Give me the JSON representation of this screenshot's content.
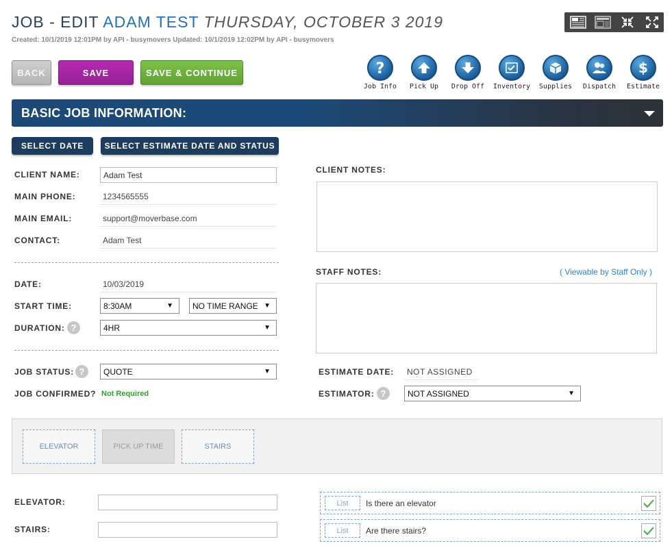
{
  "header": {
    "title_prefix": "JOB - EDIT",
    "client_name": "ADAM TEST",
    "job_date": "THURSDAY, OCTOBER 3 2019",
    "meta": "Created: 10/1/2019 12:01PM by API - busymovers Updated: 10/1/2019 12:02PM by API - busymovers"
  },
  "view_icons": [
    "layout-detail-icon",
    "layout-simple-icon",
    "collapse-icon",
    "expand-icon"
  ],
  "actions": {
    "back": "BACK",
    "save": "SAVE",
    "save_continue": "SAVE & CONTINUE"
  },
  "nav": [
    {
      "label": "Job Info",
      "icon": "question-icon"
    },
    {
      "label": "Pick Up",
      "icon": "arrow-up-icon"
    },
    {
      "label": "Drop Off",
      "icon": "arrow-down-icon"
    },
    {
      "label": "Inventory",
      "icon": "inventory-icon"
    },
    {
      "label": "Supplies",
      "icon": "box-icon"
    },
    {
      "label": "Dispatch",
      "icon": "people-icon"
    },
    {
      "label": "Estimate",
      "icon": "dollar-icon"
    }
  ],
  "section": {
    "title": "BASIC JOB INFORMATION:"
  },
  "buttons": {
    "select_date": "SELECT DATE",
    "select_estimate": "SELECT ESTIMATE DATE AND STATUS"
  },
  "fields": {
    "client_name_label": "CLIENT NAME:",
    "client_name_value": "Adam Test",
    "main_phone_label": "MAIN PHONE:",
    "main_phone_value": "1234565555",
    "main_email_label": "MAIN EMAIL:",
    "main_email_value": "support@moverbase.com",
    "contact_label": "CONTACT:",
    "contact_value": "Adam Test",
    "date_label": "DATE:",
    "date_value": "10/03/2019",
    "start_time_label": "START TIME:",
    "start_time_value": "8:30AM",
    "time_range_value": "NO TIME RANGE",
    "duration_label": "DURATION:",
    "duration_value": "4HR",
    "job_status_label": "JOB STATUS:",
    "job_status_value": "QUOTE",
    "job_confirmed_label": "JOB CONFIRMED?",
    "job_confirmed_value": "Not Required",
    "client_notes_label": "CLIENT NOTES:",
    "staff_notes_label": "STAFF NOTES:",
    "staff_notes_hint": "( Viewable by Staff Only )",
    "estimate_date_label": "ESTIMATE DATE:",
    "estimate_date_value": "NOT ASSIGNED",
    "estimator_label": "ESTIMATOR:",
    "estimator_value": "NOT ASSIGNED",
    "help_mark": "?"
  },
  "tabs": [
    "ELEVATOR",
    "PICK UP TIME",
    "STAIRS"
  ],
  "extras": {
    "elevator_label": "ELEVATOR:",
    "stairs_label": "STAIRS:",
    "list_label": "List",
    "elevator_question": "Is there an elevator",
    "stairs_question": "Are there stairs?"
  },
  "colors": {
    "save": "#a825a8",
    "save_continue": "#6db33f",
    "section_bar": "#1c4a78",
    "confirmed_text": "#2da32d",
    "link": "#1f86d9"
  }
}
